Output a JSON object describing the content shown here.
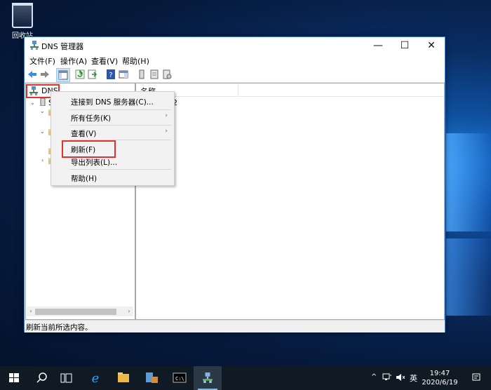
{
  "desktop": {
    "recycle_bin_label": "回收站"
  },
  "window": {
    "title": "DNS 管理器",
    "controls": {
      "minimize": "—",
      "maximize": "☐",
      "close": "✕"
    }
  },
  "menu": [
    "文件(F)",
    "操作(A)",
    "查看(V)",
    "帮助(H)"
  ],
  "tree": {
    "root_label": "DNS",
    "server_prefix": "S"
  },
  "list": {
    "column_name": "名称",
    "partial_text": "2"
  },
  "context_menu": {
    "items": [
      {
        "label": "连接到 DNS 服务器(C)..."
      },
      {
        "label": "所有任务(K)"
      },
      {
        "label": "查看(V)"
      },
      {
        "label": "刷新(F)"
      },
      {
        "label": "导出列表(L)..."
      },
      {
        "label": "帮助(H)"
      }
    ],
    "submenu_arrow": "›"
  },
  "status_text": "刷新当前所选内容。",
  "taskbar": {
    "tray": {
      "chevron": "^",
      "ime": "英"
    },
    "time": "19:47",
    "date": "2020/6/19"
  },
  "colors": {
    "accent": "#3a79c4",
    "highlight_box": "#e03030",
    "taskbar": "#101a24"
  }
}
